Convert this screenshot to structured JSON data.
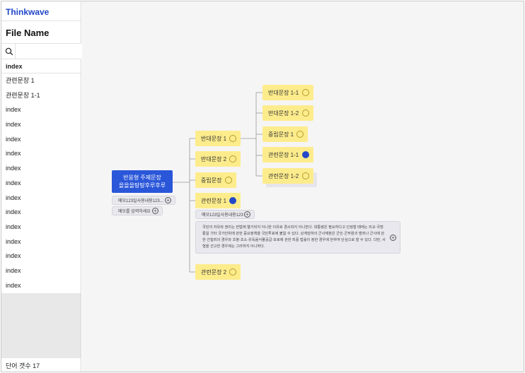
{
  "app": {
    "brand": "Thinkwave",
    "file_name": "File Name"
  },
  "search": {
    "placeholder": ""
  },
  "sidebar": {
    "items": [
      {
        "label": "index",
        "active": true
      },
      {
        "label": "관련문장 1"
      },
      {
        "label": "관련문장 1-1"
      },
      {
        "label": "index"
      },
      {
        "label": "index"
      },
      {
        "label": "index"
      },
      {
        "label": "index"
      },
      {
        "label": "index"
      },
      {
        "label": "index"
      },
      {
        "label": "index"
      },
      {
        "label": "index"
      },
      {
        "label": "index"
      },
      {
        "label": "index"
      },
      {
        "label": "index"
      },
      {
        "label": "index"
      },
      {
        "label": "index"
      }
    ],
    "word_count": "단어 갯수 17"
  },
  "map": {
    "root": {
      "line1": "반응형 주제문장",
      "line2": "을을을탕탕후루후루"
    },
    "root_memo1": "메모123일사용내용123...",
    "root_memo2": "메모를 입력하세요",
    "level1": [
      {
        "label": "반대문장 1",
        "selected": false
      },
      {
        "label": "반대문장 2",
        "selected": false
      },
      {
        "label": "중립문장",
        "selected": false
      },
      {
        "label": "관련문장 1",
        "selected": true
      },
      {
        "label": "관련문장 2",
        "selected": false
      }
    ],
    "level2": [
      {
        "label": "반대문장 1-1",
        "selected": false
      },
      {
        "label": "반대문장 1-2",
        "selected": false
      },
      {
        "label": "중립문장 1",
        "selected": false
      },
      {
        "label": "관련문장 1-1",
        "selected": true
      },
      {
        "label": "관련문장 1-2",
        "selected": false
      }
    ],
    "node_memo": "메모123일사용내용123",
    "detail_memo": "국민의 자유와 권리는 헌법에 열거되지 아니한 이유로 경시되지 아니한다. 대통령은 필요하다고 인정할 때에는 외교·국방·통일 기타 국가안위에 관한 중요정책을 국민투표에 붙일 수 있다. 상계엄하의 군사재판은 군인·군무원의 범죄나 군사에 관한 간첩죄의 경우와 초병·초소·유독음식물공급·포로에 관한 죄중 법률이 정한 경우에 한하여 단심으로 할 수 있다. 다만, 사형을 선고한 경우에는 그러하지 아니하다.",
    "colors": {
      "node": "#fdec8c",
      "root": "#2a56d9",
      "selected": "#2349c8",
      "brand": "#1f46c9"
    }
  }
}
